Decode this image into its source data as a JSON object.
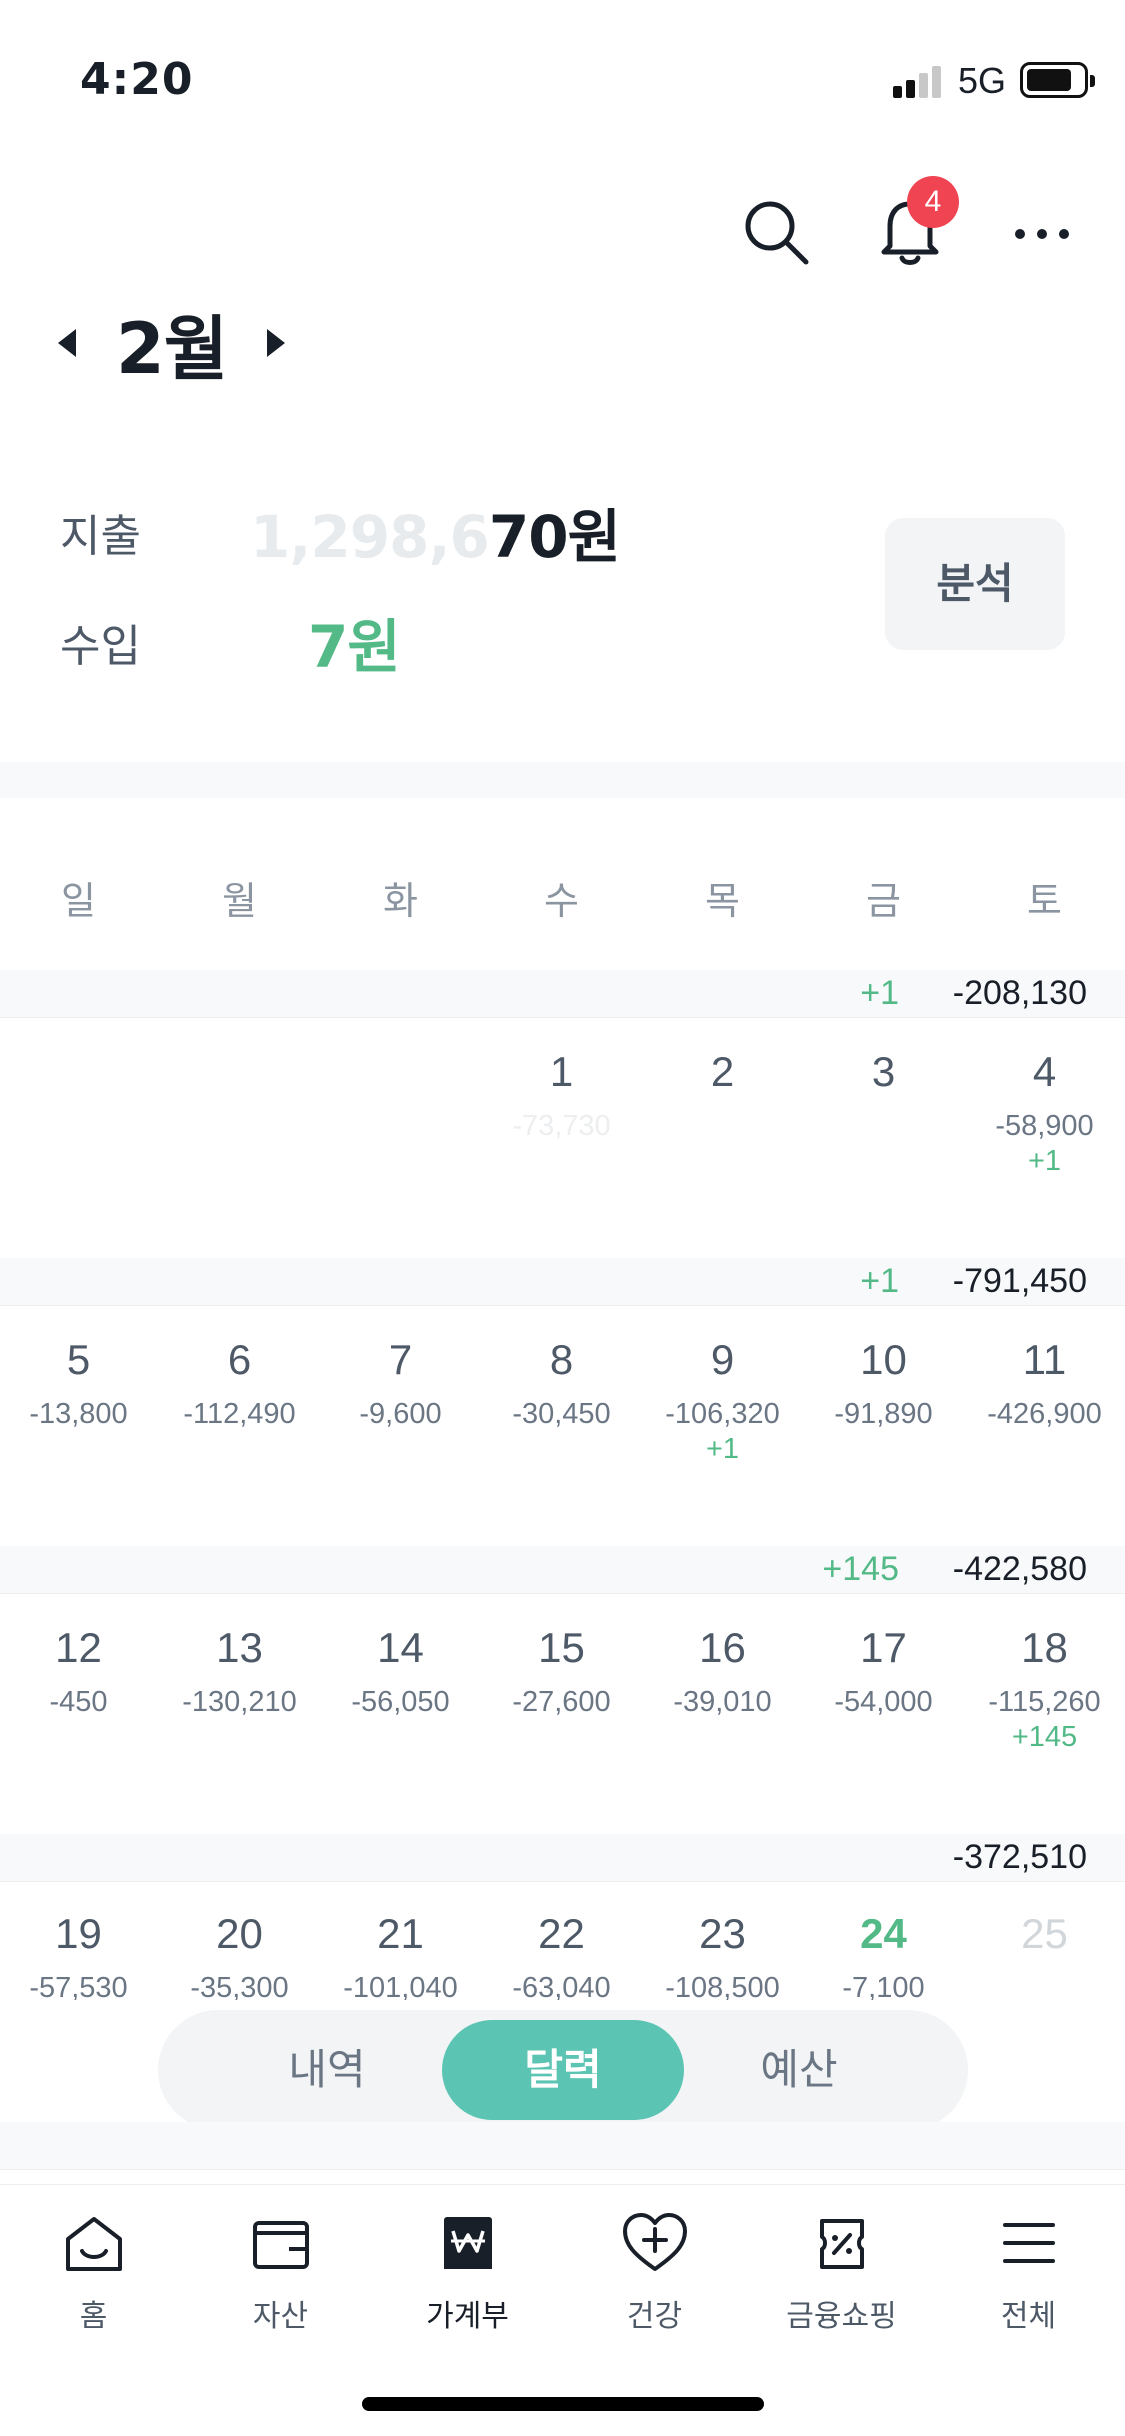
{
  "status_bar": {
    "time": "4:20",
    "network": "5G"
  },
  "header": {
    "notification_count": "4"
  },
  "month": {
    "title": "2월"
  },
  "summary": {
    "expense_label": "지출",
    "expense_hidden_part": "1,298,6",
    "expense_visible_part": "70원",
    "income_label": "수입",
    "income_value": "7원",
    "analysis_button": "분석"
  },
  "calendar": {
    "weekdays": [
      "일",
      "월",
      "화",
      "수",
      "목",
      "금",
      "토"
    ],
    "weeks": [
      {
        "income": "+1",
        "total": "-208,130",
        "days": [
          null,
          null,
          null,
          {
            "num": "1",
            "expense": "-73,730",
            "faint": true
          },
          {
            "num": "2"
          },
          {
            "num": "3"
          },
          {
            "num": "4",
            "expense": "-58,900",
            "income": "+1"
          }
        ]
      },
      {
        "income": "+1",
        "total": "-791,450",
        "days": [
          {
            "num": "5",
            "expense": "-13,800"
          },
          {
            "num": "6",
            "expense": "-112,490"
          },
          {
            "num": "7",
            "expense": "-9,600"
          },
          {
            "num": "8",
            "expense": "-30,450"
          },
          {
            "num": "9",
            "expense": "-106,320",
            "income": "+1"
          },
          {
            "num": "10",
            "expense": "-91,890"
          },
          {
            "num": "11",
            "expense": "-426,900"
          }
        ]
      },
      {
        "income": "+145",
        "total": "-422,580",
        "days": [
          {
            "num": "12",
            "expense": "-450"
          },
          {
            "num": "13",
            "expense": "-130,210"
          },
          {
            "num": "14",
            "expense": "-56,050"
          },
          {
            "num": "15",
            "expense": "-27,600"
          },
          {
            "num": "16",
            "expense": "-39,010"
          },
          {
            "num": "17",
            "expense": "-54,000"
          },
          {
            "num": "18",
            "expense": "-115,260",
            "income": "+145"
          }
        ]
      },
      {
        "income": "",
        "total": "-372,510",
        "days": [
          {
            "num": "19",
            "expense": "-57,530"
          },
          {
            "num": "20",
            "expense": "-35,300"
          },
          {
            "num": "21",
            "expense": "-101,040"
          },
          {
            "num": "22",
            "expense": "-63,040"
          },
          {
            "num": "23",
            "expense": "-108,500"
          },
          {
            "num": "24",
            "expense": "-7,100",
            "today": true
          },
          {
            "num": "25",
            "future": true
          }
        ]
      }
    ]
  },
  "segment": {
    "items": [
      "내역",
      "달력",
      "예산"
    ],
    "active": "달력"
  },
  "tab_bar": {
    "items": [
      {
        "label": "홈",
        "icon": "home-icon"
      },
      {
        "label": "자산",
        "icon": "wallet-icon"
      },
      {
        "label": "가계부",
        "icon": "won-book-icon",
        "active": true
      },
      {
        "label": "건강",
        "icon": "heart-plus-icon"
      },
      {
        "label": "금융쇼핑",
        "icon": "coupon-icon"
      },
      {
        "label": "전체",
        "icon": "menu-icon"
      }
    ]
  },
  "colors": {
    "accent_green": "#52b987",
    "segment_active": "#5cc4b3",
    "badge_red": "#f04452"
  }
}
